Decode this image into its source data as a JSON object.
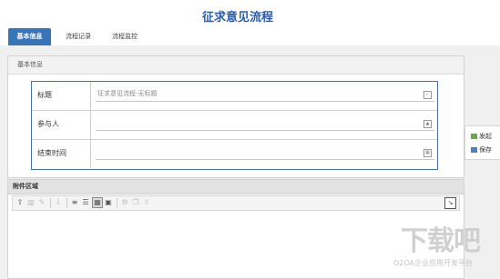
{
  "page": {
    "title": "征求意见流程"
  },
  "tabs": [
    "基本信息",
    "流程记录",
    "流程监控"
  ],
  "basic_panel": {
    "header": "基本信息",
    "fields": [
      {
        "label": "标题",
        "value": "征求意见流程-无标题",
        "icon": "checkbox-icon"
      },
      {
        "label": "参与人",
        "value": "",
        "icon": "person-picker-icon"
      },
      {
        "label": "结束时间",
        "value": "",
        "icon": "calendar-icon"
      }
    ]
  },
  "side_actions": {
    "submit": "发起",
    "save": "保存"
  },
  "attachments": {
    "header": "附件区域",
    "toolbar_icons": [
      "upload-icon",
      "delete-icon",
      "edit-icon",
      "download-icon",
      "list-view-icon",
      "detail-view-icon",
      "thumbnail-view-icon",
      "image-view-icon",
      "settings-icon",
      "copy-icon",
      "move-icon"
    ],
    "expand_icon": "expand-icon"
  },
  "watermark": {
    "big": "下载吧",
    "small": "O2OA企业应用开发平台"
  },
  "colors": {
    "accent": "#3a74b8",
    "title": "#2a5fa8"
  }
}
